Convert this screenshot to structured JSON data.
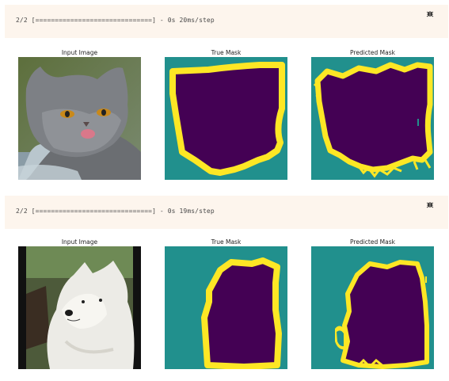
{
  "cells": [
    {
      "log": "2/2 [==============================] - 0s 20ms/step",
      "titles": [
        "Input Image",
        "True Mask",
        "Predicted Mask"
      ]
    },
    {
      "log": "2/2 [==============================] - 0s 19ms/step",
      "titles": [
        "Input Image",
        "True Mask",
        "Predicted Mask"
      ]
    }
  ],
  "colors": {
    "mask_background": "#21908d",
    "mask_pet": "#440154",
    "mask_border": "#fde725",
    "output_bg": "#fdf5ed"
  }
}
